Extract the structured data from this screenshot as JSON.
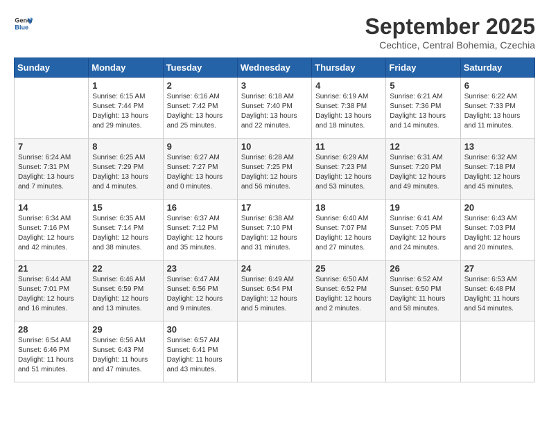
{
  "logo": {
    "line1": "General",
    "line2": "Blue"
  },
  "title": "September 2025",
  "subtitle": "Cechtice, Central Bohemia, Czechia",
  "days_header": [
    "Sunday",
    "Monday",
    "Tuesday",
    "Wednesday",
    "Thursday",
    "Friday",
    "Saturday"
  ],
  "weeks": [
    [
      {
        "day": "",
        "info": ""
      },
      {
        "day": "1",
        "info": "Sunrise: 6:15 AM\nSunset: 7:44 PM\nDaylight: 13 hours\nand 29 minutes."
      },
      {
        "day": "2",
        "info": "Sunrise: 6:16 AM\nSunset: 7:42 PM\nDaylight: 13 hours\nand 25 minutes."
      },
      {
        "day": "3",
        "info": "Sunrise: 6:18 AM\nSunset: 7:40 PM\nDaylight: 13 hours\nand 22 minutes."
      },
      {
        "day": "4",
        "info": "Sunrise: 6:19 AM\nSunset: 7:38 PM\nDaylight: 13 hours\nand 18 minutes."
      },
      {
        "day": "5",
        "info": "Sunrise: 6:21 AM\nSunset: 7:36 PM\nDaylight: 13 hours\nand 14 minutes."
      },
      {
        "day": "6",
        "info": "Sunrise: 6:22 AM\nSunset: 7:33 PM\nDaylight: 13 hours\nand 11 minutes."
      }
    ],
    [
      {
        "day": "7",
        "info": "Sunrise: 6:24 AM\nSunset: 7:31 PM\nDaylight: 13 hours\nand 7 minutes."
      },
      {
        "day": "8",
        "info": "Sunrise: 6:25 AM\nSunset: 7:29 PM\nDaylight: 13 hours\nand 4 minutes."
      },
      {
        "day": "9",
        "info": "Sunrise: 6:27 AM\nSunset: 7:27 PM\nDaylight: 13 hours\nand 0 minutes."
      },
      {
        "day": "10",
        "info": "Sunrise: 6:28 AM\nSunset: 7:25 PM\nDaylight: 12 hours\nand 56 minutes."
      },
      {
        "day": "11",
        "info": "Sunrise: 6:29 AM\nSunset: 7:23 PM\nDaylight: 12 hours\nand 53 minutes."
      },
      {
        "day": "12",
        "info": "Sunrise: 6:31 AM\nSunset: 7:20 PM\nDaylight: 12 hours\nand 49 minutes."
      },
      {
        "day": "13",
        "info": "Sunrise: 6:32 AM\nSunset: 7:18 PM\nDaylight: 12 hours\nand 45 minutes."
      }
    ],
    [
      {
        "day": "14",
        "info": "Sunrise: 6:34 AM\nSunset: 7:16 PM\nDaylight: 12 hours\nand 42 minutes."
      },
      {
        "day": "15",
        "info": "Sunrise: 6:35 AM\nSunset: 7:14 PM\nDaylight: 12 hours\nand 38 minutes."
      },
      {
        "day": "16",
        "info": "Sunrise: 6:37 AM\nSunset: 7:12 PM\nDaylight: 12 hours\nand 35 minutes."
      },
      {
        "day": "17",
        "info": "Sunrise: 6:38 AM\nSunset: 7:10 PM\nDaylight: 12 hours\nand 31 minutes."
      },
      {
        "day": "18",
        "info": "Sunrise: 6:40 AM\nSunset: 7:07 PM\nDaylight: 12 hours\nand 27 minutes."
      },
      {
        "day": "19",
        "info": "Sunrise: 6:41 AM\nSunset: 7:05 PM\nDaylight: 12 hours\nand 24 minutes."
      },
      {
        "day": "20",
        "info": "Sunrise: 6:43 AM\nSunset: 7:03 PM\nDaylight: 12 hours\nand 20 minutes."
      }
    ],
    [
      {
        "day": "21",
        "info": "Sunrise: 6:44 AM\nSunset: 7:01 PM\nDaylight: 12 hours\nand 16 minutes."
      },
      {
        "day": "22",
        "info": "Sunrise: 6:46 AM\nSunset: 6:59 PM\nDaylight: 12 hours\nand 13 minutes."
      },
      {
        "day": "23",
        "info": "Sunrise: 6:47 AM\nSunset: 6:56 PM\nDaylight: 12 hours\nand 9 minutes."
      },
      {
        "day": "24",
        "info": "Sunrise: 6:49 AM\nSunset: 6:54 PM\nDaylight: 12 hours\nand 5 minutes."
      },
      {
        "day": "25",
        "info": "Sunrise: 6:50 AM\nSunset: 6:52 PM\nDaylight: 12 hours\nand 2 minutes."
      },
      {
        "day": "26",
        "info": "Sunrise: 6:52 AM\nSunset: 6:50 PM\nDaylight: 11 hours\nand 58 minutes."
      },
      {
        "day": "27",
        "info": "Sunrise: 6:53 AM\nSunset: 6:48 PM\nDaylight: 11 hours\nand 54 minutes."
      }
    ],
    [
      {
        "day": "28",
        "info": "Sunrise: 6:54 AM\nSunset: 6:46 PM\nDaylight: 11 hours\nand 51 minutes."
      },
      {
        "day": "29",
        "info": "Sunrise: 6:56 AM\nSunset: 6:43 PM\nDaylight: 11 hours\nand 47 minutes."
      },
      {
        "day": "30",
        "info": "Sunrise: 6:57 AM\nSunset: 6:41 PM\nDaylight: 11 hours\nand 43 minutes."
      },
      {
        "day": "",
        "info": ""
      },
      {
        "day": "",
        "info": ""
      },
      {
        "day": "",
        "info": ""
      },
      {
        "day": "",
        "info": ""
      }
    ]
  ]
}
